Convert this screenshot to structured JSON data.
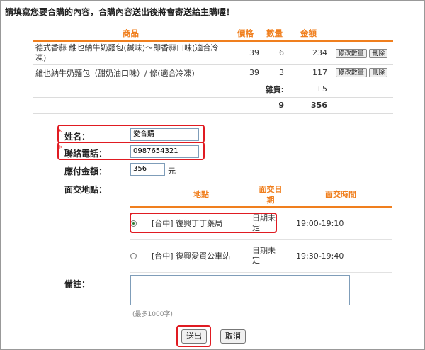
{
  "page": {
    "title": "請填寫您要合購的內容，合購內容送出後將會寄送給主購喔！"
  },
  "cart": {
    "headers": {
      "product": "商品",
      "price": "價格",
      "qty": "數量",
      "amount": "金額"
    },
    "edit_qty_label": "修改數量",
    "delete_label": "刪除",
    "items": [
      {
        "name": "德式香蒜 維也納牛奶麵包(鹹味)～即香蒜口味(適合冷凍)",
        "price": "39",
        "qty": "6",
        "amount": "234"
      },
      {
        "name": "維也納牛奶麵包（甜奶油口味）/ 條(適合冷凍)",
        "price": "39",
        "qty": "3",
        "amount": "117"
      }
    ],
    "misc_label": "雜費:",
    "misc_value": "+5",
    "total_qty": "9",
    "total_amount": "356"
  },
  "form": {
    "name_label": "姓名：",
    "name_value": "愛合購",
    "phone_label": "聯絡電話：",
    "phone_value": "0987654321",
    "pay_label": "應付金額：",
    "pay_value": "356",
    "pay_unit": "元",
    "meet_label": "面交地點：",
    "note_label": "備註：",
    "note_hint": "(最多1000字)",
    "required_mark": "*"
  },
  "meetup": {
    "headers": {
      "location": "地點",
      "date": "面交日期",
      "time": "面交時間"
    },
    "rows": [
      {
        "location": "[台中] 復興丁丁藥局",
        "date": "日期未定",
        "time": "19:00-19:10",
        "selected": true
      },
      {
        "location": "[台中] 復興愛買公車站",
        "date": "日期未定",
        "time": "19:30-19:40",
        "selected": false
      }
    ]
  },
  "actions": {
    "submit_label": "送出",
    "cancel_label": "取消"
  },
  "colors": {
    "accent": "#f07f1e",
    "highlight": "#e01b22"
  }
}
